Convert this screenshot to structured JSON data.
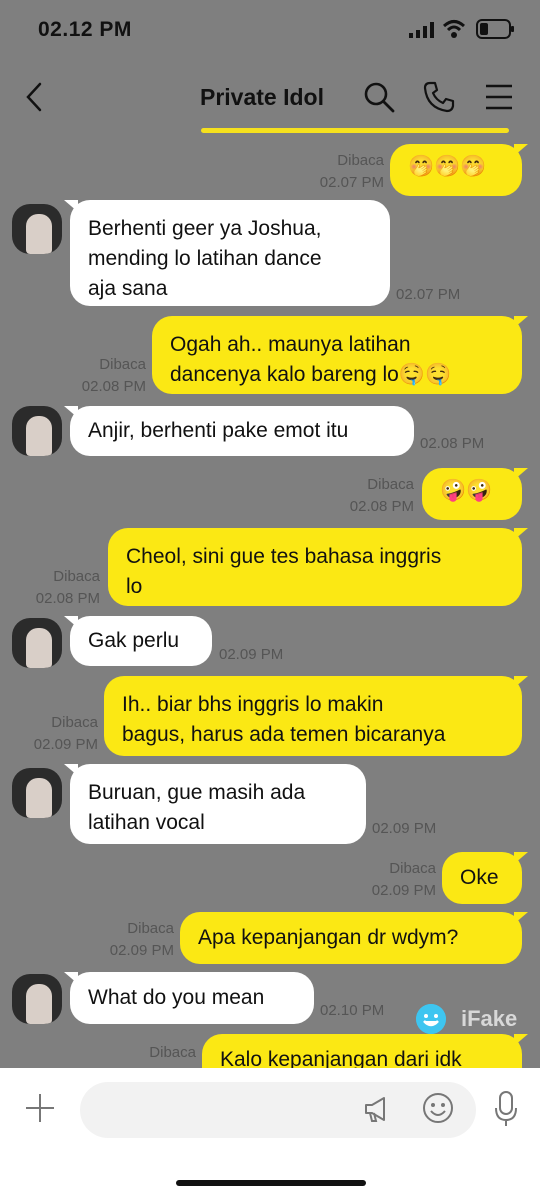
{
  "status_bar": {
    "time": "02.12 PM"
  },
  "header": {
    "title": "Private Idol"
  },
  "messages": [
    {
      "dir": "out",
      "text": "🤭🤭🤭",
      "read": "Dibaca",
      "time": "02.07 PM"
    },
    {
      "dir": "in",
      "text": "Berhenti geer ya Joshua,\nmending lo latihan dance\naja sana",
      "time": "02.07 PM"
    },
    {
      "dir": "out",
      "text": "Ogah ah.. maunya latihan\ndancenya kalo bareng lo🤤🤤",
      "read": "Dibaca",
      "time": "02.08 PM"
    },
    {
      "dir": "in",
      "text": "Anjir, berhenti pake emot itu",
      "time": "02.08 PM"
    },
    {
      "dir": "out",
      "text": "🤪🤪",
      "read": "Dibaca",
      "time": "02.08 PM"
    },
    {
      "dir": "out",
      "text": "Cheol, sini gue tes bahasa inggris\nlo",
      "read": "Dibaca",
      "time": "02.08 PM"
    },
    {
      "dir": "in",
      "text": "Gak perlu",
      "time": "02.09 PM"
    },
    {
      "dir": "out",
      "text": "Ih.. biar bhs inggris lo makin\nbagus, harus ada temen bicaranya",
      "read": "Dibaca",
      "time": "02.09 PM"
    },
    {
      "dir": "in",
      "text": "Buruan, gue masih ada\nlatihan vocal",
      "time": "02.09 PM"
    },
    {
      "dir": "out",
      "text": "Oke",
      "read": "Dibaca",
      "time": "02.09 PM"
    },
    {
      "dir": "out",
      "text": "Apa kepanjangan dr wdym?",
      "read": "Dibaca",
      "time": "02.09 PM"
    },
    {
      "dir": "in",
      "text": "What do you mean",
      "time": "02.10 PM"
    },
    {
      "dir": "out",
      "text": "Kalo kepanjangan dari idk",
      "read": "Dibaca",
      "time": ""
    }
  ],
  "watermark": "iFake",
  "icons": [
    "back-chevron-icon",
    "search-icon",
    "phone-icon",
    "menu-icon",
    "plus-icon",
    "megaphone-icon",
    "emoji-icon",
    "mic-icon"
  ]
}
